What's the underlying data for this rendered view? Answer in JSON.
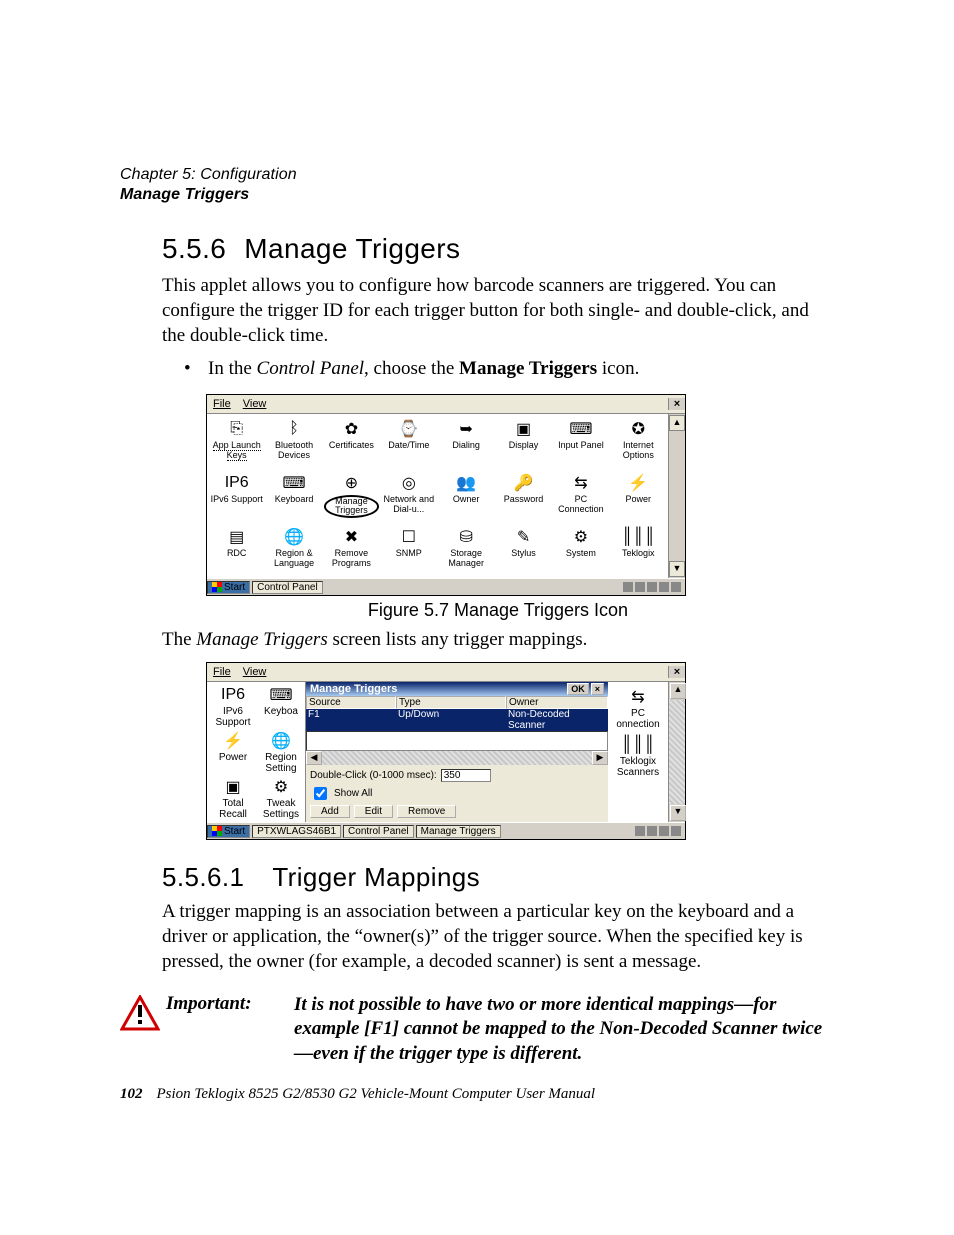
{
  "header": {
    "chapter": "Chapter 5: Configuration",
    "section_title": "Manage Triggers"
  },
  "sec1": {
    "num": "5.5.6",
    "title": "Manage Triggers",
    "p1": "This applet allows you to configure how barcode scanners are triggered. You can configure the trigger ID for each trigger button for both single- and double-click, and the double-click time.",
    "bullet_prefix": "In the ",
    "bullet_em": "Control Panel",
    "bullet_mid": ", choose the ",
    "bullet_strong": "Manage Triggers",
    "bullet_suffix": " icon."
  },
  "fig1": {
    "caption": "Figure 5.7 Manage Triggers Icon",
    "menu_file": "File",
    "menu_view": "View",
    "close": "×",
    "icons": [
      {
        "glyph": "⎘",
        "label": "App Launch Keys"
      },
      {
        "glyph": "ᛒ",
        "label": "Bluetooth Devices"
      },
      {
        "glyph": "✿",
        "label": "Certificates"
      },
      {
        "glyph": "⌚",
        "label": "Date/Time"
      },
      {
        "glyph": "➥",
        "label": "Dialing"
      },
      {
        "glyph": "▣",
        "label": "Display"
      },
      {
        "glyph": "⌨",
        "label": "Input Panel"
      },
      {
        "glyph": "✪",
        "label": "Internet Options"
      },
      {
        "glyph": "IP6",
        "label": "IPv6 Support"
      },
      {
        "glyph": "⌨",
        "label": "Keyboard"
      },
      {
        "glyph": "⊕",
        "label": "Manage Triggers",
        "highlight": true
      },
      {
        "glyph": "◎",
        "label": "Network and Dial-u..."
      },
      {
        "glyph": "👥",
        "label": "Owner"
      },
      {
        "glyph": "🔑",
        "label": "Password"
      },
      {
        "glyph": "⇆",
        "label": "PC Connection"
      },
      {
        "glyph": "⚡",
        "label": "Power"
      },
      {
        "glyph": "▤",
        "label": "RDC"
      },
      {
        "glyph": "🌐",
        "label": "Region & Language"
      },
      {
        "glyph": "✖",
        "label": "Remove Programs"
      },
      {
        "glyph": "☐",
        "label": "SNMP"
      },
      {
        "glyph": "⛁",
        "label": "Storage Manager"
      },
      {
        "glyph": "✎",
        "label": "Stylus"
      },
      {
        "glyph": "⚙",
        "label": "System"
      },
      {
        "glyph": "║║║",
        "label": "Teklogix"
      }
    ],
    "taskbar_start": "Start",
    "taskbar_btn": "Control Panel"
  },
  "mid_para_pre": "The ",
  "mid_para_em": "Manage Triggers",
  "mid_para_post": " screen lists any trigger mappings.",
  "fig2": {
    "menu_file": "File",
    "menu_view": "View",
    "close": "×",
    "left_icons": [
      {
        "glyph": "IP6",
        "label": "IPv6 Support"
      },
      {
        "glyph": "⌨",
        "label": "Keyboa"
      },
      {
        "glyph": "⚡",
        "label": "Power"
      },
      {
        "glyph": "🌐",
        "label": "Region Setting"
      },
      {
        "glyph": "▣",
        "label": "Total Recall"
      },
      {
        "glyph": "⚙",
        "label": "Tweak Settings"
      }
    ],
    "pane_title": "Manage Triggers",
    "ok": "OK",
    "col_source": "Source",
    "col_type": "Type",
    "col_owner": "Owner",
    "row_source": "F1",
    "row_type": "Up/Down",
    "row_owner": "Non-Decoded Scanner",
    "dbl_label": "Double-Click (0-1000 msec):",
    "dbl_value": "350",
    "show_all": "Show All",
    "btn_add": "Add",
    "btn_edit": "Edit",
    "btn_remove": "Remove",
    "right_icons": [
      {
        "glyph": "⇆",
        "label": "PC onnection"
      },
      {
        "glyph": "║║║",
        "label": "Teklogix Scanners"
      }
    ],
    "taskbar_start": "Start",
    "taskbar_b1": "PTXWLAGS46B1",
    "taskbar_b2": "Control Panel",
    "taskbar_b3": "Manage Triggers"
  },
  "sec2": {
    "num": "5.5.6.1",
    "title": "Trigger Mappings",
    "p1": "A trigger mapping is an association between a particular key on the keyboard and a driver or application, the “owner(s)” of the trigger source. When the specified key is pressed, the owner (for example, a decoded scanner) is sent a message."
  },
  "important": {
    "label": "Important:",
    "text": "It is not possible to have two or more identical mappings—for example [F1] cannot be mapped to the Non-Decoded Scanner twice—even if the trigger type is different."
  },
  "footer": {
    "page": "102",
    "text": "Psion Teklogix 8525 G2/8530 G2 Vehicle-Mount Computer User Manual"
  }
}
